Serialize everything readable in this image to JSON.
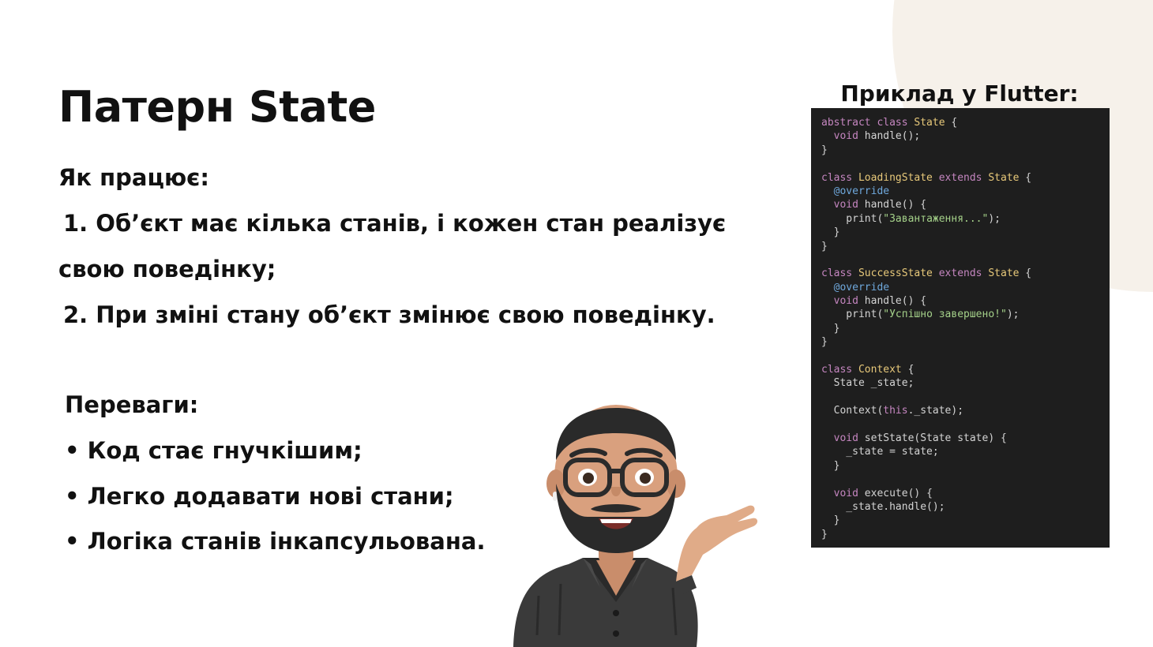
{
  "slide": {
    "title": "Патерн State",
    "how_it_works": {
      "heading": "Як працює:",
      "point1_line1": " 1. Об’єкт має кілька станів, і кожен стан реалізує",
      "point1_line2": "свою поведінку;",
      "point2": " 2. При зміні стану об’єкт змінює свою поведінку."
    },
    "advantages": {
      "heading": "Переваги:",
      "items": [
        "• Код стає гнучкішим;",
        "• Легко додавати нові стани;",
        "• Логіка станів інкапсульована."
      ]
    },
    "code_example": {
      "caption": "Приклад у Flutter:",
      "lines": [
        [
          [
            "kw",
            "abstract class "
          ],
          [
            "type",
            "State"
          ],
          [
            "plain",
            " {"
          ]
        ],
        [
          [
            "kw",
            "  void "
          ],
          [
            "plain",
            "handle();"
          ]
        ],
        [
          [
            "plain",
            "}"
          ]
        ],
        [],
        [
          [
            "kw",
            "class "
          ],
          [
            "type",
            "LoadingState "
          ],
          [
            "kw",
            "extends "
          ],
          [
            "type",
            "State"
          ],
          [
            "plain",
            " {"
          ]
        ],
        [
          [
            "ann",
            "  @override"
          ]
        ],
        [
          [
            "kw",
            "  void "
          ],
          [
            "plain",
            "handle() {"
          ]
        ],
        [
          [
            "plain",
            "    print("
          ],
          [
            "str",
            "\"Завантаження...\""
          ],
          [
            "plain",
            ");"
          ]
        ],
        [
          [
            "plain",
            "  }"
          ]
        ],
        [
          [
            "plain",
            "}"
          ]
        ],
        [],
        [
          [
            "kw",
            "class "
          ],
          [
            "type",
            "SuccessState "
          ],
          [
            "kw",
            "extends "
          ],
          [
            "type",
            "State"
          ],
          [
            "plain",
            " {"
          ]
        ],
        [
          [
            "ann",
            "  @override"
          ]
        ],
        [
          [
            "kw",
            "  void "
          ],
          [
            "plain",
            "handle() {"
          ]
        ],
        [
          [
            "plain",
            "    print("
          ],
          [
            "str",
            "\"Успішно завершено!\""
          ],
          [
            "plain",
            ");"
          ]
        ],
        [
          [
            "plain",
            "  }"
          ]
        ],
        [
          [
            "plain",
            "}"
          ]
        ],
        [],
        [
          [
            "kw",
            "class "
          ],
          [
            "type",
            "Context"
          ],
          [
            "plain",
            " {"
          ]
        ],
        [
          [
            "plain",
            "  State _state;"
          ]
        ],
        [],
        [
          [
            "plain",
            "  Context("
          ],
          [
            "kw",
            "this"
          ],
          [
            "plain",
            "._state);"
          ]
        ],
        [],
        [
          [
            "kw",
            "  void "
          ],
          [
            "plain",
            "setState(State state) {"
          ]
        ],
        [
          [
            "plain",
            "    _state = state;"
          ]
        ],
        [
          [
            "plain",
            "  }"
          ]
        ],
        [],
        [
          [
            "kw",
            "  void "
          ],
          [
            "plain",
            "execute() {"
          ]
        ],
        [
          [
            "plain",
            "    _state.handle();"
          ]
        ],
        [
          [
            "plain",
            "  }"
          ]
        ],
        [
          [
            "plain",
            "}"
          ]
        ]
      ]
    },
    "colors": {
      "background": "#ffffff",
      "accent_circle": "#f6f1ea",
      "text": "#111111",
      "code_background": "#1e1e1e",
      "code_keyword": "#c586c0",
      "code_type": "#e8c97a",
      "code_annotation": "#6fa8dc",
      "code_string": "#a5d28a"
    },
    "avatar": {
      "icon": "memoji-presenter-avatar"
    }
  }
}
